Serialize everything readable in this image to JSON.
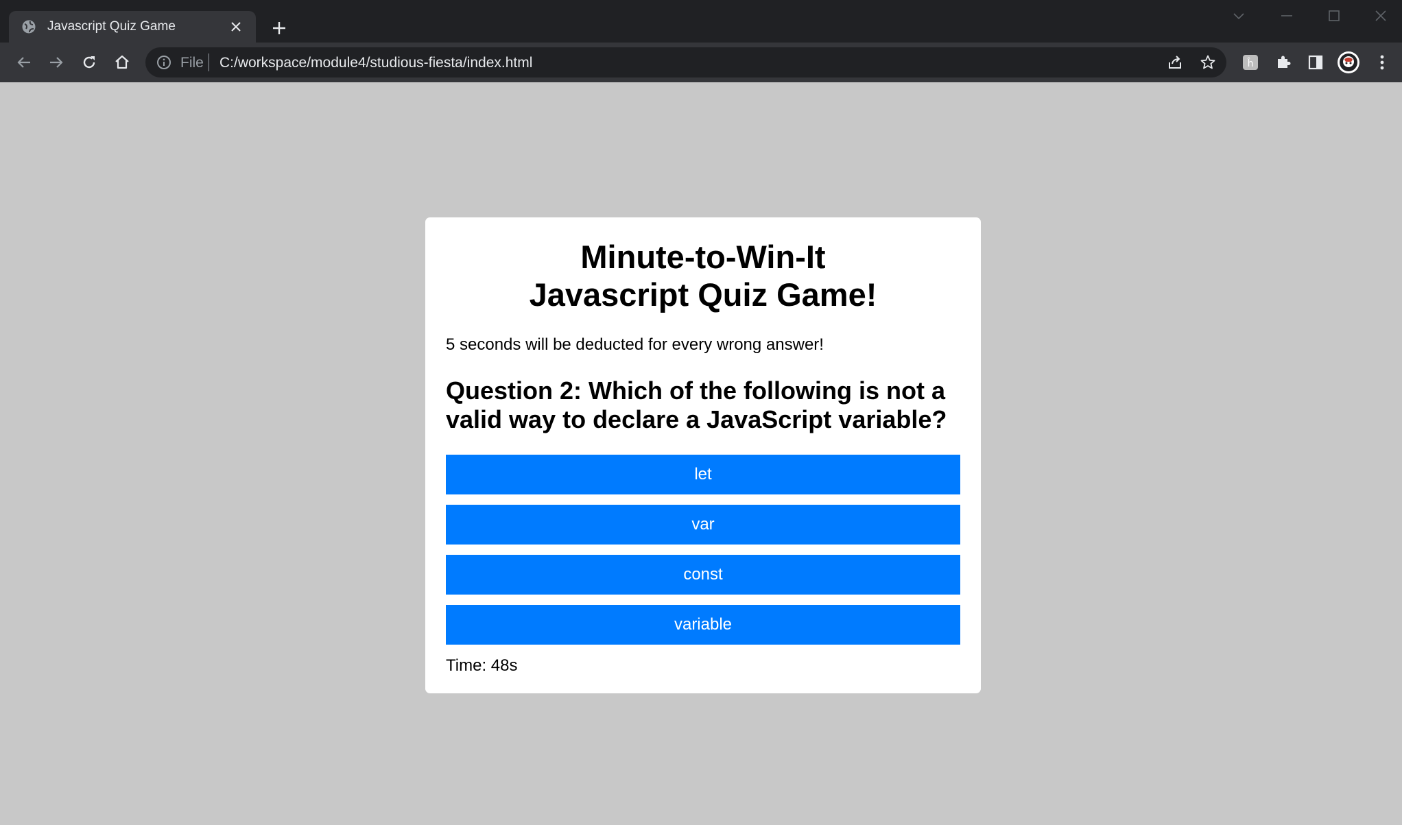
{
  "browser": {
    "tab_title": "Javascript Quiz Game",
    "url_scheme": "File",
    "url": "C:/workspace/module4/studious-fiesta/index.html"
  },
  "quiz": {
    "title_line1": "Minute-to-Win-It",
    "title_line2": "Javascript Quiz Game!",
    "note": "5 seconds will be deducted for every wrong answer!",
    "question": "Question 2: Which of the following is not a valid way to declare a JavaScript variable?",
    "answers": [
      "let",
      "var",
      "const",
      "variable"
    ],
    "timer": "Time: 48s"
  },
  "colors": {
    "page_bg": "#c8c8c8",
    "answer_button": "#007bff",
    "chrome_dark": "#202124",
    "chrome_toolbar": "#35363a"
  },
  "icons": [
    "globe-icon",
    "close-icon",
    "plus-icon",
    "chevron-down-icon",
    "minimize-icon",
    "maximize-icon",
    "back-arrow-icon",
    "forward-arrow-icon",
    "reload-icon",
    "home-icon",
    "info-icon",
    "share-icon",
    "star-icon",
    "extension-icon",
    "puzzle-icon",
    "side-panel-icon",
    "avatar",
    "kebab-menu-icon"
  ]
}
